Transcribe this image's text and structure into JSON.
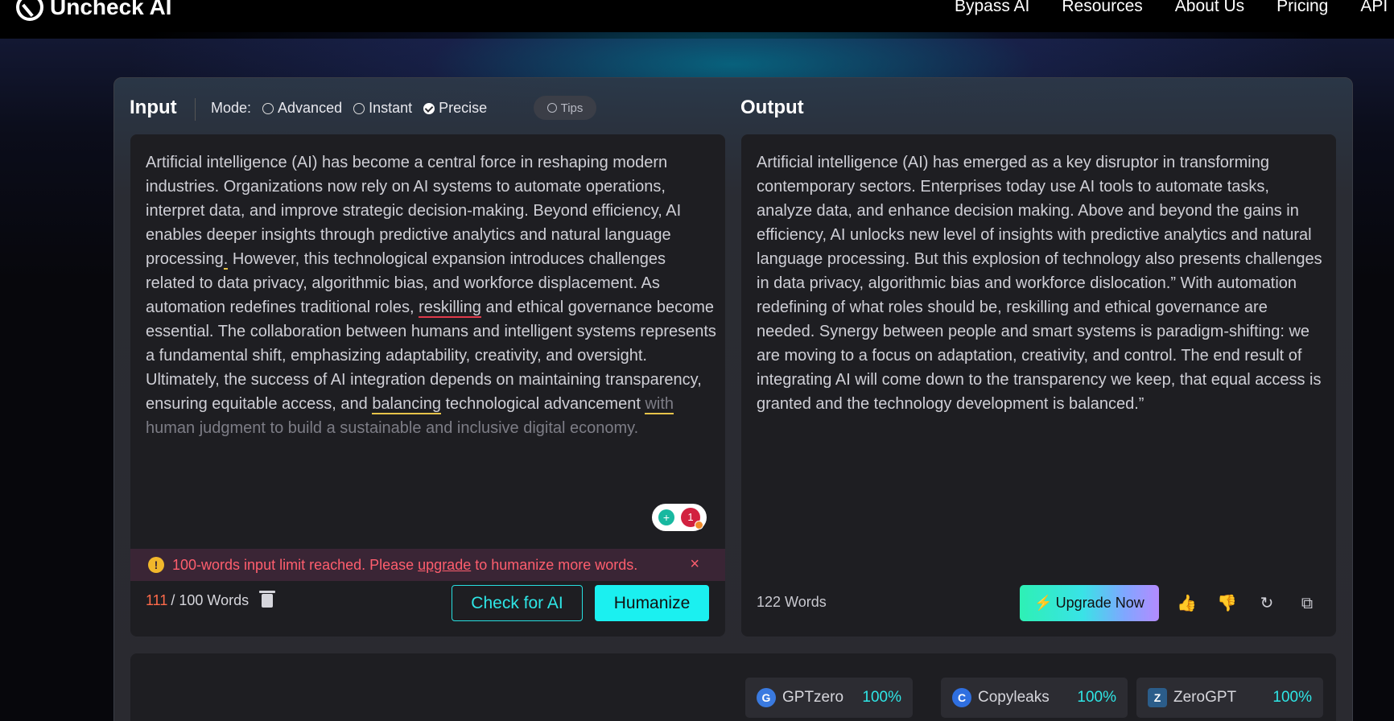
{
  "nav": {
    "logo_text": "Uncheck AI",
    "links": [
      "Bypass AI",
      "Resources",
      "About Us",
      "Pricing",
      "API"
    ]
  },
  "input": {
    "title": "Input",
    "mode_label": "Mode:",
    "modes": [
      "Advanced",
      "Instant",
      "Precise"
    ],
    "selected_mode": "Precise",
    "tips_label": "Tips",
    "text_parts": [
      {
        "t": "Artificial intelligence (AI) has become a central force in reshaping modern industries. Organizations now rely on AI systems to automate operations, interpret data, and improve strategic decision-making. Beyond efficiency, AI enables deeper insights through predictive analytics and natural language processing",
        "s": ""
      },
      {
        "t": ".",
        "s": "u-y"
      },
      {
        "t": " However, this technological expansion introduces challenges related to data privacy, algorithmic bias, and workforce displacement. As automation redefines traditional roles, ",
        "s": ""
      },
      {
        "t": "reskilling",
        "s": "u-r"
      },
      {
        "t": " and ethical governance become essential. The collaboration between humans and intelligent systems represents a fundamental shift, emphasizing adaptability, creativity, and oversight. Ultimately, the success of AI integration depends on maintaining transparency, ensuring equitable access, and ",
        "s": ""
      },
      {
        "t": "balancing",
        "s": "u-y"
      },
      {
        "t": " technological advancement ",
        "s": ""
      },
      {
        "t": "with",
        "s": "u-y faded"
      },
      {
        "t": " human judgment to build a sustainable and inclusive digital economy.",
        "s": "faded"
      }
    ],
    "suggestion_count": "1",
    "limit_msg_before": "100-words input limit reached. Please ",
    "limit_msg_link": "upgrade",
    "limit_msg_after": " to humanize more words.",
    "limit_close": "×",
    "word_count_current": "111",
    "word_count_rest": " / 100 Words",
    "check_button": "Check for AI",
    "humanize_button": "Humanize"
  },
  "output": {
    "title": "Output",
    "text": "Artificial intelligence (AI) has emerged as a key disruptor in transforming contemporary sectors. Enterprises today use AI tools to automate tasks, analyze data, and enhance decision making. Above and beyond the gains in efficiency, AI unlocks new level of insights with predictive analytics and natural language processing. But this explosion of technology also presents challenges in data privacy, algorithmic bias and workforce dislocation.” With automation redefining of what roles should be, reskilling and ethical governance are needed. Synergy between people and smart systems is paradigm-shifting: we are moving to a focus on adaptation, creativity, and control. The end result of integrating AI will come down to the transparency we keep, that equal access is granted and the technology development is balanced.”",
    "word_count": "122 Words",
    "upgrade_button": "Upgrade Now"
  },
  "detectors": [
    {
      "name": "GPTzero",
      "value": "100%"
    },
    {
      "name": "Copyleaks",
      "value": "100%"
    },
    {
      "name": "ZeroGPT",
      "value": "100%"
    }
  ]
}
